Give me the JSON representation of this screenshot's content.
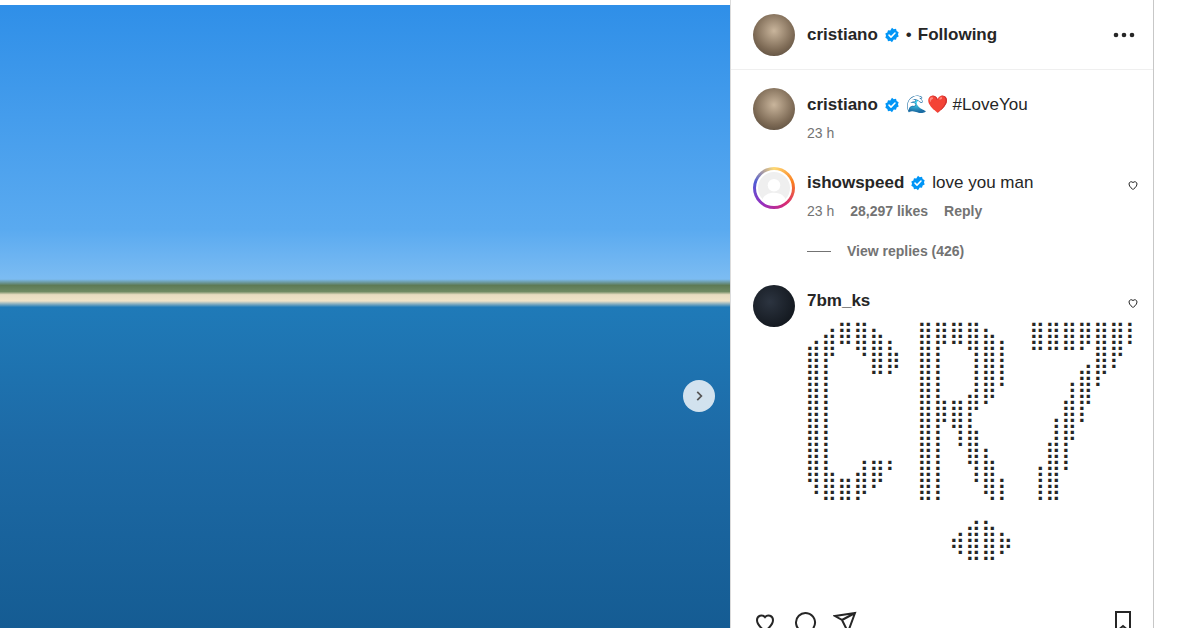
{
  "header": {
    "username": "cristiano",
    "verified": true,
    "separator": "•",
    "follow": "Following"
  },
  "caption": {
    "username": "cristiano",
    "verified": true,
    "text": "🌊❤️ #LoveYou",
    "time": "23 h"
  },
  "comments": [
    {
      "kind": "text",
      "username": "ishowspeed",
      "verified": true,
      "story_ring": true,
      "text": "love you man",
      "time": "23 h",
      "likes": "28,297 likes",
      "reply": "Reply",
      "view_replies": "View replies (426)"
    },
    {
      "kind": "art",
      "username": "7bm_ks",
      "verified": false,
      "story_ring": false,
      "art": [
        "⢀⣴⣿⣿⣦⡀⠀⣿⣿⣿⣿⣦⡀⠀⣿⣿⣿⣿⣿⣿⡇",
        "⣿⡟⠀⠙⣿⣷⠀⣿⡇⠀⢹⣿⡇⠀⠉⠉⠉⢁⣿⡟",
        "⣿⡇⠀⠀⠉⠁⠀⣿⡇⠀⢸⣿⠇⠀⠀⠀⢠⣿⠏⠀",
        "⣿⡇⠀⠀⠀⠀⠀⣿⣷⣶⡿⠋⠀⠀⠀⠀⣾⡟⠀⠀",
        "⣿⡇⠀⠀⠀⠀⠀⣿⡏⢻⣧⠀⠀⠀⠀⢸⣿⠁⠀⠀",
        "⣿⡇⠀⢀⣀⡀⠀⣿⡇⠈⣿⣆⠀⠀⠀⣿⡇⠀⠀⠀",
        "⢿⣷⣤⣾⡿⠁⠀⣿⡇⠀⠸⣿⡄⠀⢸⣿⠁⠀⠀⠀",
        "⠈⠛⠛⠋⠀⠀⠀⠛⠃⠀⠀⠙⠃⠀⠘⠛⠀⠀⠀⠀",
        "⠀⠀⠀⠀⠀⠀⠀⠀⠀⢀⣴⣦⡀⠀⠀⠀⠀⠀⠀⠀",
        "⠀⠀⠀⠀⠀⠀⠀⠀⠀⠻⣿⣿⠟⠀⠀⠀⠀⠀⠀⠀"
      ]
    }
  ]
}
